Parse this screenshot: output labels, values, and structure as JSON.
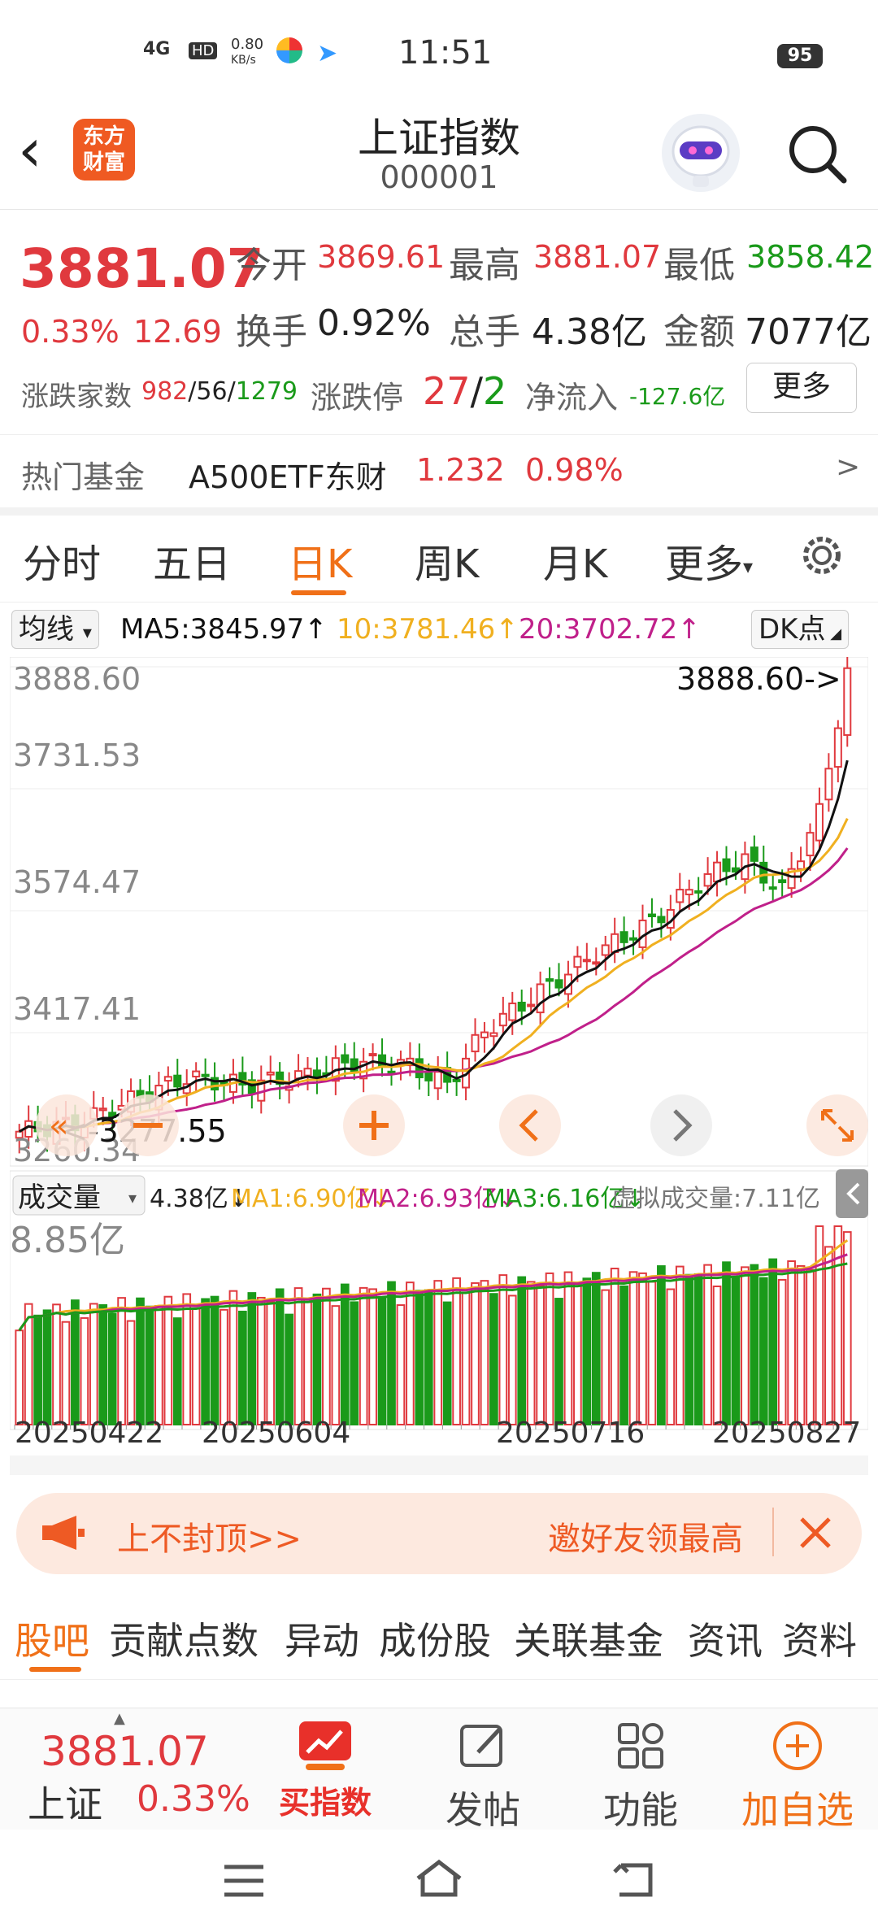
{
  "status_bar": {
    "signal": "4G",
    "hd": "HD",
    "speed_value": "0.80",
    "speed_unit": "KB/s",
    "time": "11:51",
    "battery": "95"
  },
  "header": {
    "logo_line1": "东方",
    "logo_line2": "财富",
    "title": "上证指数",
    "code": "000001"
  },
  "quote": {
    "price": "3881.07",
    "change_pct": "0.33%",
    "change_pts": "12.69",
    "open_label": "今开",
    "open": "3869.61",
    "high_label": "最高",
    "high": "3881.07",
    "low_label": "最低",
    "low": "3858.42",
    "turnover_label": "换手",
    "turnover": "0.92%",
    "volume_label": "总手",
    "volume": "4.38亿",
    "amount_label": "金额",
    "amount": "7077亿",
    "breadth_label": "涨跌家数",
    "breadth_up": "982",
    "breadth_flat": "56",
    "breadth_down": "1279",
    "limit_label": "涨跌停",
    "limit_up": "27",
    "limit_down": "2",
    "netflow_label": "净流入",
    "netflow": "-127.6亿",
    "more_button": "更多"
  },
  "hot_fund": {
    "label": "热门基金",
    "name": "A500ETF东财",
    "price": "1.232",
    "pct": "0.98%",
    "arrow": ">"
  },
  "tabs": [
    {
      "label": "分时"
    },
    {
      "label": "五日"
    },
    {
      "label": "日K"
    },
    {
      "label": "周K"
    },
    {
      "label": "月K"
    },
    {
      "label": "更多"
    }
  ],
  "tab_more_arrow": "▾",
  "ma_row": {
    "selector": "均线",
    "ma5": "MA5:3845.97↑",
    "ma10": "10:3781.46↑",
    "ma20": "20:3702.72↑",
    "dk": "DK点"
  },
  "price_chart": {
    "y_labels": [
      "3888.60",
      "3731.53",
      "3574.47",
      "3417.41",
      "3260.34"
    ],
    "max_label": "3888.60->",
    "min_label": "<-3277.55"
  },
  "volume_panel": {
    "selector": "成交量",
    "vol": "4.38亿↓",
    "ma1": "MA1:6.90亿↓",
    "ma2": "MA2:6.93亿↓",
    "ma3": "MA3:6.16亿↓",
    "virtual": "虚拟成交量:7.11亿",
    "max_label": "8.85亿"
  },
  "x_dates": [
    "20250422",
    "20250604",
    "20250716",
    "20250827"
  ],
  "chart_data": {
    "type": "candlestick",
    "y_range": [
      3260.34,
      3888.6
    ],
    "max": 3888.6,
    "min": 3277.55,
    "x_dates": [
      "20250422",
      "20250604",
      "20250716",
      "20250827"
    ],
    "ma5_last": 3845.97,
    "ma10_last": 3781.46,
    "ma20_last": 3702.72,
    "volume_max": 8.85,
    "volume_unit": "亿"
  },
  "banner": {
    "left": "上不封顶>>",
    "right": "邀好友领最高"
  },
  "subtabs": [
    "股吧",
    "贡献点数",
    "异动",
    "成份股",
    "关联基金",
    "资讯",
    "资料"
  ],
  "bottom": {
    "price": "3881.07",
    "name": "上证",
    "pct": "0.33%",
    "buy": "买指数",
    "post": "发帖",
    "func": "功能",
    "watch": "加自选"
  },
  "colors": {
    "up": "#e0393e",
    "down": "#1a9a1a",
    "accent": "#f07018",
    "ma5": "#111111",
    "ma10": "#f0b020",
    "ma20": "#c0208a"
  }
}
